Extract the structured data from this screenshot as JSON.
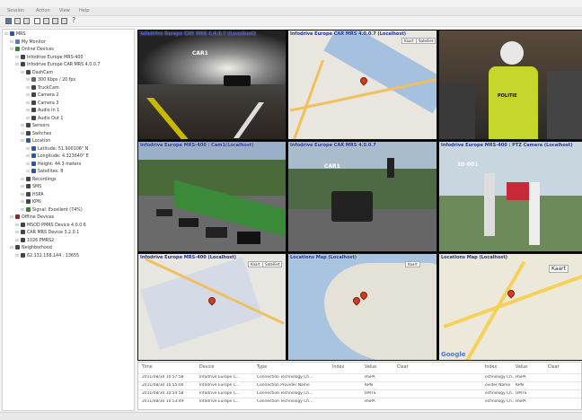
{
  "menu": [
    "Session",
    "Action",
    "View",
    "Help"
  ],
  "tree": [
    {
      "label": "MRS",
      "indent": 0,
      "icon": "#2a55b0"
    },
    {
      "label": "My Monitor",
      "indent": 1,
      "icon": "#4f7bc9"
    },
    {
      "label": "Online Devices",
      "indent": 1,
      "icon": "#2b8a2b"
    },
    {
      "label": "Infodrive Europe MRS-400",
      "indent": 2,
      "icon": "#444"
    },
    {
      "label": "Infodrive Europe CAR MRS 4.0.0.7",
      "indent": 2,
      "icon": "#444"
    },
    {
      "label": "DashCam",
      "indent": 3,
      "icon": "#444"
    },
    {
      "label": "300 Kbps / 20 fps",
      "indent": 4,
      "icon": "#666"
    },
    {
      "label": "TruckCam",
      "indent": 4,
      "icon": "#444"
    },
    {
      "label": "Camera 2",
      "indent": 4,
      "icon": "#444"
    },
    {
      "label": "Camera 3",
      "indent": 4,
      "icon": "#444"
    },
    {
      "label": "Audio In 1",
      "indent": 4,
      "icon": "#444"
    },
    {
      "label": "Audio Out 1",
      "indent": 4,
      "icon": "#444"
    },
    {
      "label": "Sensors",
      "indent": 3,
      "icon": "#444"
    },
    {
      "label": "Switches",
      "indent": 3,
      "icon": "#444"
    },
    {
      "label": "Location",
      "indent": 3,
      "icon": "#2a55b0"
    },
    {
      "label": "Latitude: 51.900106° N",
      "indent": 4,
      "icon": "#2a55b0"
    },
    {
      "label": "Longitude: 4.323640° E",
      "indent": 4,
      "icon": "#2a55b0"
    },
    {
      "label": "Height: 44.3 meters",
      "indent": 4,
      "icon": "#2a55b0"
    },
    {
      "label": "Satellites: 8",
      "indent": 4,
      "icon": "#2a55b0"
    },
    {
      "label": "Recordings",
      "indent": 3,
      "icon": "#444"
    },
    {
      "label": "SMS",
      "indent": 3,
      "icon": "#444"
    },
    {
      "label": "HSPA",
      "indent": 3,
      "icon": "#444"
    },
    {
      "label": "KPN",
      "indent": 3,
      "icon": "#444"
    },
    {
      "label": "Signal: Excellent (74%)",
      "indent": 3,
      "icon": "#2b8a2b"
    },
    {
      "label": "Offline Devices",
      "indent": 1,
      "icon": "#a02020"
    },
    {
      "label": "MSOD PMRS Device 4.0.0.6",
      "indent": 2,
      "icon": "#444"
    },
    {
      "label": "CAR MRS Device 3.2.0.1",
      "indent": 2,
      "icon": "#444"
    },
    {
      "label": "1026 PMRS2",
      "indent": 2,
      "icon": "#444"
    },
    {
      "label": "Neighborhood",
      "indent": 1,
      "icon": "#444"
    },
    {
      "label": "62.132.158.144 : 13655",
      "indent": 2,
      "icon": "#444"
    }
  ],
  "cells": [
    {
      "caption": "Infodrive Europe CAR MRS 4.0.0.7 (Localhost)",
      "osd": "CAR1",
      "type": "video"
    },
    {
      "caption": "Infodrive Europe CAR MRS 4.0.0.7 (Localhost)",
      "type": "map"
    },
    {
      "caption": "",
      "type": "photo"
    },
    {
      "caption": "Infodrive Europe MRS-400 : Cam1(Localhost)",
      "osd": "",
      "type": "video2"
    },
    {
      "caption": "Infodrive Europe CAR MRS 4.0.0.7",
      "osd": "CAR1",
      "type": "video3"
    },
    {
      "caption": "Infodrive Europe MRS-400 : PTZ Camera (Localhost)",
      "osd": "10-001",
      "type": "video4"
    },
    {
      "caption": "Infodrive Europe MRS-400 (Localhost)",
      "type": "map2"
    },
    {
      "caption": "Locations Map (Localhost)",
      "type": "map3"
    },
    {
      "caption": "Locations Map (Localhost)",
      "type": "map4"
    }
  ],
  "map_buttons": [
    "Kaart",
    "Satelliet"
  ],
  "map_kaart": "Kaart",
  "google_logo": "Google",
  "politie": "POLITIE",
  "events": {
    "headers": [
      "Time",
      "Device",
      "Type",
      "Index",
      "Value",
      "Clear",
      "Index",
      "Value",
      "Clear"
    ],
    "rows": [
      [
        "2011/08/30 10:57:58",
        "Infodrive Europe C...",
        "Connection Technology Ch...",
        "",
        "HSPA",
        "",
        "echnology Ch...",
        "HSPA",
        ""
      ],
      [
        "2011/08/30 10:55:00",
        "Infodrive Europe C...",
        "Connection Provider Name",
        "",
        "KPN",
        "",
        "ovider Name",
        "KPN",
        ""
      ],
      [
        "2011/08/30 10:54:58",
        "Infodrive Europe C...",
        "Connection Technology Ch...",
        "",
        "UMTS",
        "",
        "echnology Ch...",
        "UMTS",
        ""
      ],
      [
        "2011/08/30 10:53:49",
        "Infodrive Europe C...",
        "Connection Technology Ch...",
        "",
        "HSPA",
        "",
        "echnology Ch...",
        "HSPA",
        ""
      ]
    ]
  }
}
